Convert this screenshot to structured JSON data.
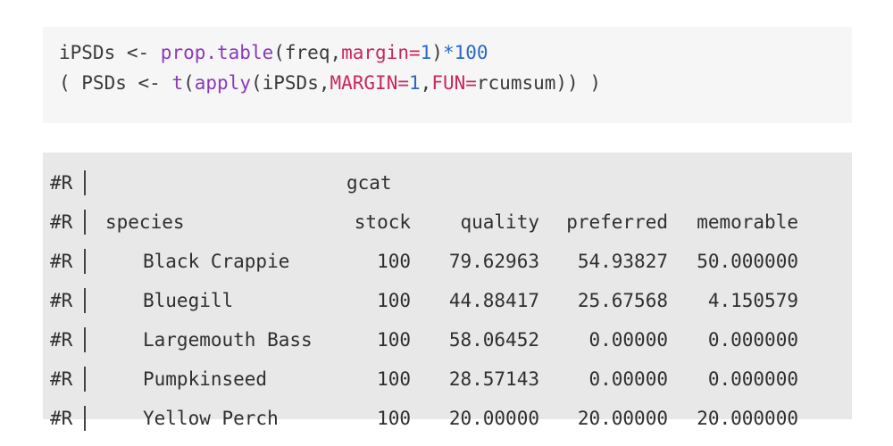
{
  "code": {
    "line1": {
      "var": "iPSDs",
      "assign": " <- ",
      "fn": "prop.table",
      "open": "(",
      "arg1": "freq,",
      "argname": "margin=",
      "argval": "1",
      "close": ")",
      "mult": "*",
      "num": "100"
    },
    "line2": {
      "lead": "( PSDs <- ",
      "fn_t": "t",
      "open1": "(",
      "fn_apply": "apply",
      "open2": "(",
      "arg1": "iPSDs,",
      "argname1": "MARGIN=",
      "argval1": "1",
      "comma": ",",
      "argname2": "FUN=",
      "argval2": "rcumsum",
      "close": ")) )"
    }
  },
  "output": {
    "prefix": "#R",
    "header_group": "gcat",
    "columns": [
      "species",
      "stock",
      "quality",
      "preferred",
      "memorable"
    ],
    "rows": [
      {
        "species": "Black Crappie",
        "stock": "100",
        "quality": "79.62963",
        "preferred": "54.93827",
        "memorable": "50.000000"
      },
      {
        "species": "Bluegill",
        "stock": "100",
        "quality": "44.88417",
        "preferred": "25.67568",
        "memorable": "4.150579"
      },
      {
        "species": "Largemouth Bass",
        "stock": "100",
        "quality": "58.06452",
        "preferred": "0.00000",
        "memorable": "0.000000"
      },
      {
        "species": "Pumpkinseed",
        "stock": "100",
        "quality": "28.57143",
        "preferred": "0.00000",
        "memorable": "0.000000"
      },
      {
        "species": "Yellow Perch",
        "stock": "100",
        "quality": "20.00000",
        "preferred": "20.00000",
        "memorable": "20.000000"
      }
    ]
  }
}
